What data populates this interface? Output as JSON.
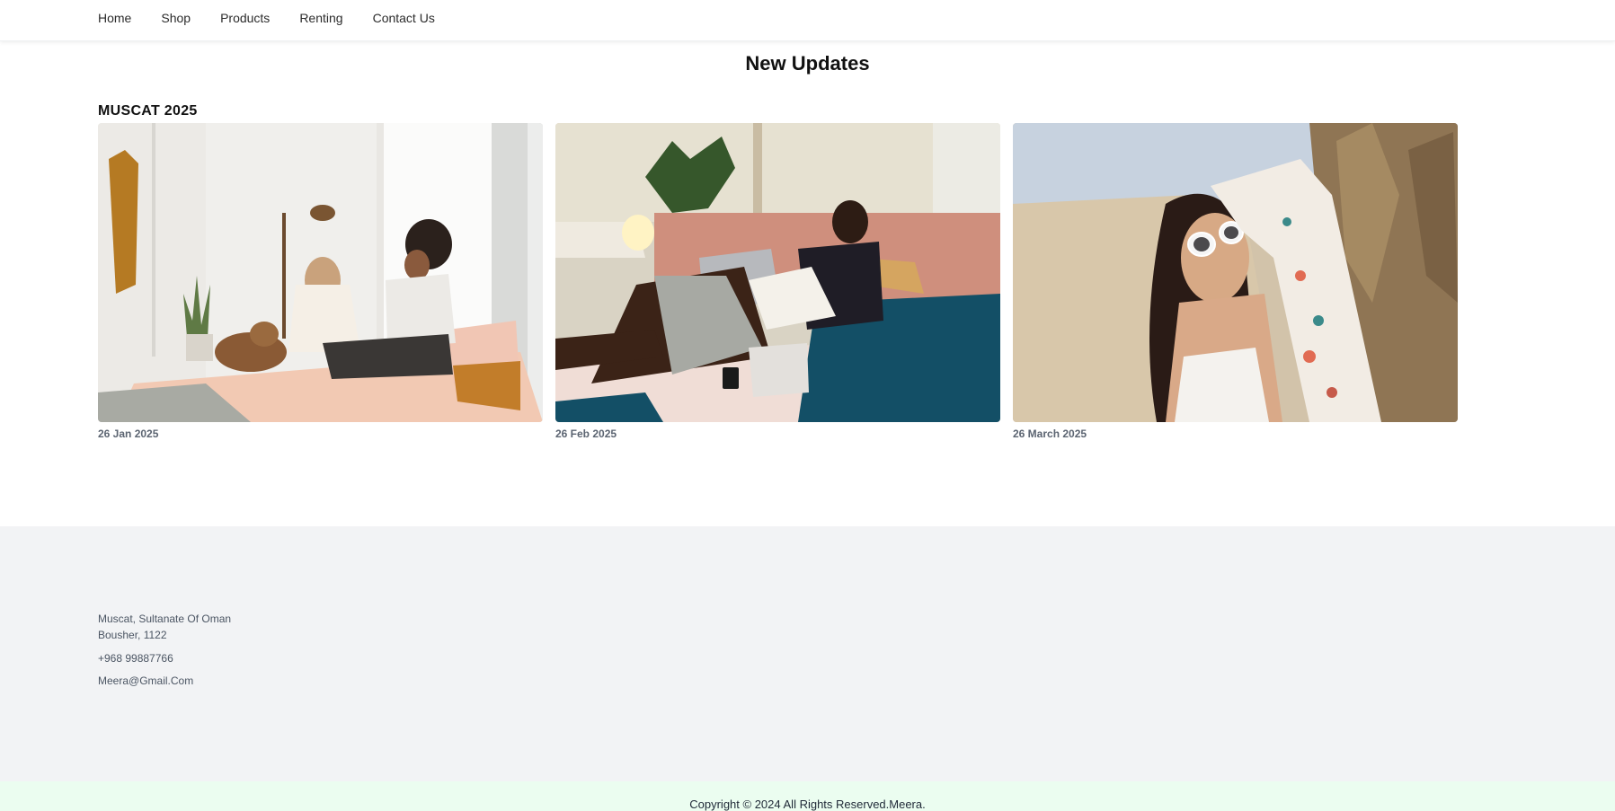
{
  "nav": {
    "items": [
      {
        "label": "Home"
      },
      {
        "label": "Shop"
      },
      {
        "label": "Products"
      },
      {
        "label": "Renting"
      },
      {
        "label": "Contact Us"
      }
    ]
  },
  "page": {
    "title": "New Updates"
  },
  "section": {
    "heading": "MUSCAT 2025",
    "cards": [
      {
        "image_name": "bedroom-women-dog-photo",
        "date": "26 Jan 2025"
      },
      {
        "image_name": "man-reading-book-photo",
        "date": "26 Feb 2025"
      },
      {
        "image_name": "woman-sunglasses-beach-photo",
        "date": "26 March 2025"
      }
    ]
  },
  "footer": {
    "address_line1": "Muscat, Sultanate Of Oman",
    "address_line2": "Bousher, 1122",
    "phone": "+968 99887766",
    "email": "Meera@Gmail.Com",
    "copyright": "Copyright © 2024 All Rights Reserved.Meera."
  },
  "colors": {
    "footer_bg": "#f2f3f5",
    "copyright_bg": "#ebfdf0"
  }
}
